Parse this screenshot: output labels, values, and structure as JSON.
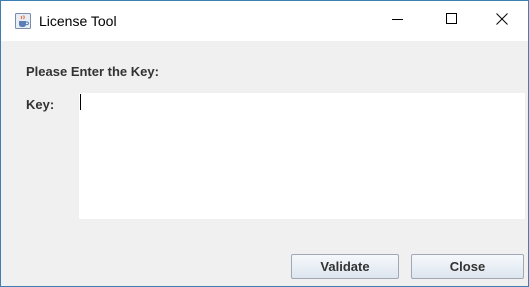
{
  "window": {
    "title": "License Tool",
    "icon": "java-cup-icon",
    "controls": {
      "minimize_icon": "minimize-icon",
      "maximize_icon": "maximize-icon",
      "close_icon": "close-icon"
    }
  },
  "form": {
    "prompt": "Please Enter the Key:",
    "key_label": "Key:",
    "key_value": ""
  },
  "buttons": {
    "validate_label": "Validate",
    "close_label": "Close"
  },
  "colors": {
    "window_border": "#3c7fb1",
    "background": "#f0f0f0",
    "label_text": "#333333"
  }
}
